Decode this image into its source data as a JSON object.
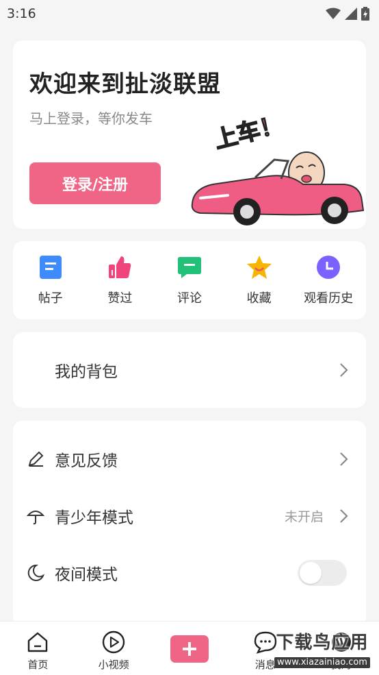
{
  "status_bar": {
    "time": "3:16"
  },
  "welcome": {
    "title": "欢迎来到扯淡联盟",
    "subtitle": "马上登录，等你发车",
    "login_button": "登录/注册",
    "illustration_caption": "上车！"
  },
  "shortcuts": [
    {
      "label": "帖子",
      "icon": "post-icon",
      "color": "#3d8bfd"
    },
    {
      "label": "赞过",
      "icon": "thumbs-up-icon",
      "color": "#f0457a"
    },
    {
      "label": "评论",
      "icon": "comment-icon",
      "color": "#22c17a"
    },
    {
      "label": "收藏",
      "icon": "star-icon",
      "color": "#f7b500"
    },
    {
      "label": "观看历史",
      "icon": "clock-icon",
      "color": "#7b61ff"
    }
  ],
  "backpack": {
    "label": "我的背包"
  },
  "settings": {
    "feedback": {
      "label": "意见反馈",
      "icon": "pencil-icon"
    },
    "youth_mode": {
      "label": "青少年模式",
      "value": "未开启",
      "icon": "umbrella-icon"
    },
    "night_mode": {
      "label": "夜间模式",
      "icon": "moon-icon",
      "enabled": false
    }
  },
  "bottom_nav": [
    {
      "label": "首页",
      "icon": "home-icon"
    },
    {
      "label": "小视频",
      "icon": "play-icon"
    },
    {
      "label": "",
      "icon": "add-icon"
    },
    {
      "label": "消息",
      "icon": "message-icon"
    },
    {
      "label": "我的",
      "icon": "profile-icon"
    }
  ],
  "watermark": {
    "main": "下载鸟应用",
    "sub": "www.xiazainiao.com"
  },
  "colors": {
    "accent": "#f06585",
    "background": "#f5f5f5"
  }
}
